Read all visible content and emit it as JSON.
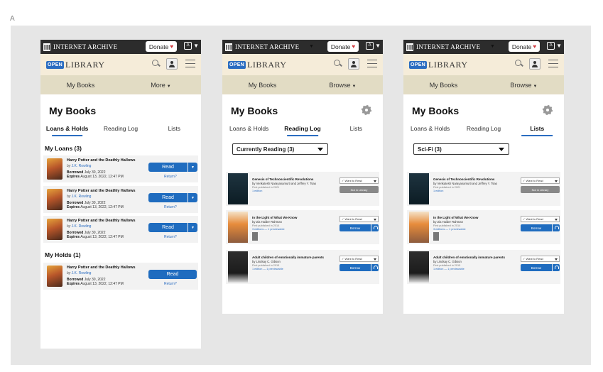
{
  "frame_label": "A",
  "header": {
    "ia_title": "INTERNET ARCHIVE",
    "donate_label": "Donate",
    "donate_heart": "♥",
    "ol_open": "OPEN",
    "ol_library": "LIBRARY"
  },
  "screen1": {
    "nav": {
      "my_books": "My Books",
      "more": "More"
    },
    "title": "My Books",
    "tabs": [
      "Loans & Holds",
      "Reading Log",
      "Lists"
    ],
    "loans_heading": "My Loans (3)",
    "holds_heading": "My Holds (1)",
    "loans": [
      {
        "title": "Harry Potter and the Deathly Hallows",
        "by": "by",
        "author": "J.K. Rowling",
        "borrowed_label": "Borrowed",
        "borrowed": "July 30, 2022",
        "expires_label": "Expires",
        "expires": "August 13, 2022, 12:47 PM",
        "read": "Read",
        "return": "Return?"
      },
      {
        "title": "Harry Potter and the Deathly Hallows",
        "by": "by",
        "author": "J.K. Rowling",
        "borrowed_label": "Borrowed",
        "borrowed": "July 30, 2022",
        "expires_label": "Expires",
        "expires": "August 13, 2022, 12:47 PM",
        "read": "Read",
        "return": "Return?"
      },
      {
        "title": "Harry Potter and the Deathly Hallows",
        "by": "by",
        "author": "J.K. Rowling",
        "borrowed_label": "Borrowed",
        "borrowed": "July 30, 2022",
        "expires_label": "Expires",
        "expires": "August 13, 2022, 12:47 PM",
        "read": "Read",
        "return": "Return?"
      }
    ],
    "holds": [
      {
        "title": "Harry Potter and the Deathly Hallows",
        "by": "by",
        "author": "J.K. Rowling",
        "borrowed_label": "Borrowed",
        "borrowed": "July 30, 2022",
        "expires_label": "Expires",
        "expires": "August 13, 2022, 12:47 PM",
        "read": "Read",
        "return": "Return?"
      }
    ]
  },
  "screen2": {
    "nav": {
      "my_books": "My Books",
      "browse": "Browse"
    },
    "title": "My Books",
    "tabs": [
      "Loans & Holds",
      "Reading Log",
      "Lists"
    ],
    "shelf": "Currently Reading (3)"
  },
  "screen3": {
    "nav": {
      "my_books": "My Books",
      "browse": "Browse"
    },
    "title": "My Books",
    "tabs": [
      "Loans & Holds",
      "Reading Log",
      "Lists"
    ],
    "shelf": "Sci-Fi (3)"
  },
  "books": [
    {
      "title": "Genesis of Technoscientific Revolutions",
      "author": "by Venkatesh Narayanamurti and Jeffrey Y. Tsao",
      "published": "First published in 2021",
      "editions": "1 edition",
      "select": "✓ Want to Read",
      "action": "Not in Library"
    },
    {
      "title": "In the Light of What We Know",
      "author": "by Zia Haider Rahman",
      "published": "First published in 2014",
      "editions": "3 editions — 1 previewable",
      "select": "✓ Want to Read",
      "action": "Borrow"
    },
    {
      "title": "Adult children of emotionally immature parents",
      "author": "by Lindsay C. Gibson",
      "published": "First published in 2015",
      "editions": "1 edition — 1 previewable",
      "select": "✓ Want to Read",
      "action": "Borrow"
    }
  ]
}
